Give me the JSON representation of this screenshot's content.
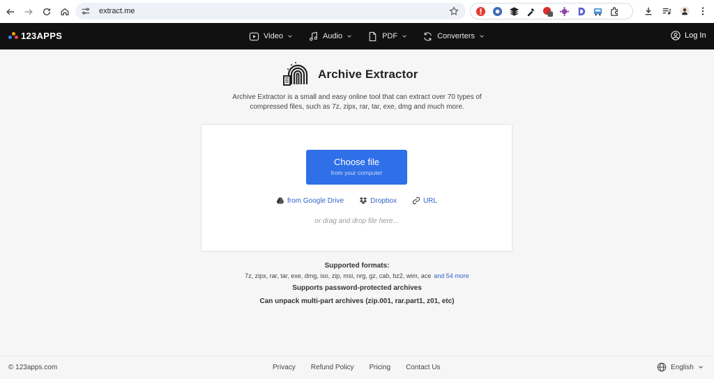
{
  "browser": {
    "url": "extract.me"
  },
  "site": {
    "brand": "123APPS",
    "brand_colors": [
      "#3b82f6",
      "#f59e0b",
      "#ef4444"
    ],
    "menu": [
      {
        "label": "Video",
        "icon": "play-icon"
      },
      {
        "label": "Audio",
        "icon": "music-note-icon"
      },
      {
        "label": "PDF",
        "icon": "document-icon"
      },
      {
        "label": "Converters",
        "icon": "convert-icon"
      }
    ],
    "login_label": "Log In"
  },
  "main": {
    "title": "Archive Extractor",
    "description": "Archive Extractor is a small and easy online tool that can extract over 70 types of compressed files, such as 7z, zipx, rar, tar, exe, dmg and much more.",
    "choose_file": {
      "label": "Choose file",
      "sublabel": "from your computer"
    },
    "sources": [
      {
        "label": "from Google Drive",
        "icon": "google-drive-icon"
      },
      {
        "label": "Dropbox",
        "icon": "dropbox-icon"
      },
      {
        "label": "URL",
        "icon": "link-icon"
      }
    ],
    "drag_hint": "or drag and drop file here...",
    "supported_heading": "Supported formats:",
    "supported_list": "7z, zipx, rar, tar, exe, dmg, iso, zip, msi, nrg, gz, cab, bz2, wim, ace",
    "more_link": "and 54 more",
    "features": [
      "Supports password-protected archives",
      "Can unpack multi-part archives (zip.001, rar.part1, z01, etc)"
    ],
    "accent_color": "#2f6fe8"
  },
  "footer": {
    "copyright": "© 123apps.com",
    "links": [
      "Privacy",
      "Refund Policy",
      "Pricing",
      "Contact Us"
    ],
    "language": "English"
  }
}
